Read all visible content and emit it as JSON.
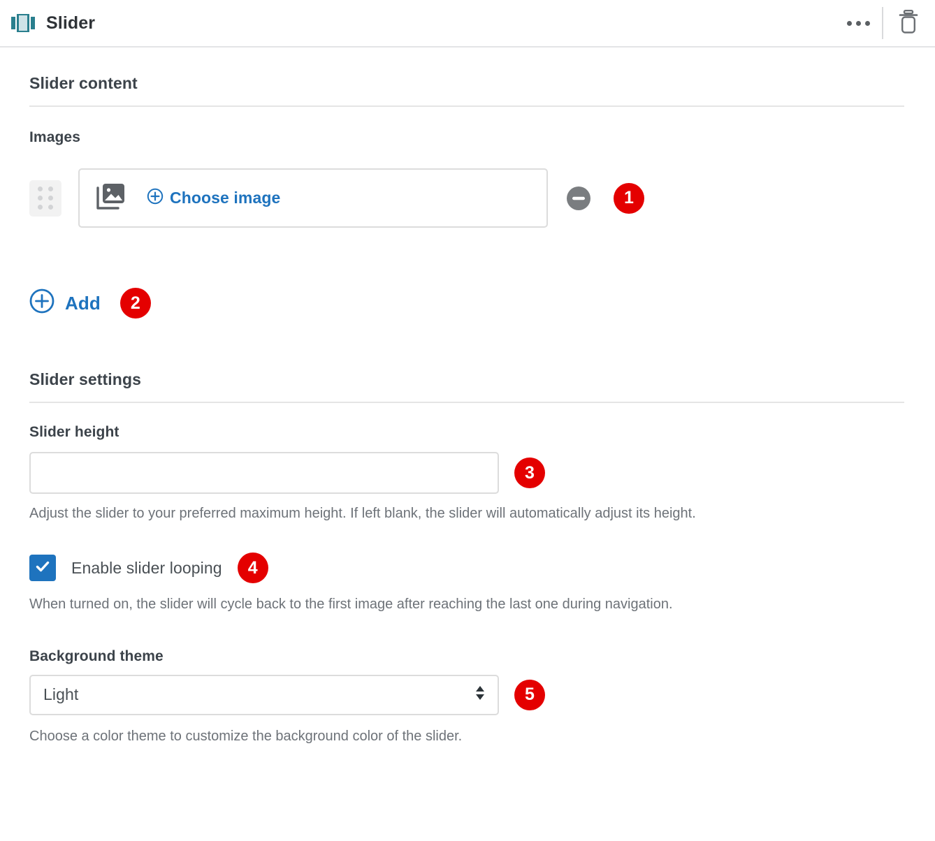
{
  "header": {
    "title": "Slider",
    "block_icon": "slider-carousel-icon",
    "more_options_icon": "ellipsis-icon",
    "delete_icon": "trash-icon"
  },
  "content_section": {
    "title": "Slider content",
    "images_label": "Images",
    "image_row": {
      "drag_handle_icon": "drag-handle-icon",
      "photo_icon": "photo-stack-icon",
      "choose_image_label": "Choose image",
      "choose_image_plus_icon": "plus-circle-icon",
      "remove_icon": "minus-circle-icon",
      "badge": "1"
    },
    "add_button": {
      "label": "Add",
      "icon": "plus-circle-icon",
      "badge": "2"
    }
  },
  "settings_section": {
    "title": "Slider settings",
    "slider_height": {
      "label": "Slider height",
      "value": "",
      "placeholder": "",
      "help": "Adjust the slider to your preferred maximum height. If left blank, the slider will automatically adjust its height.",
      "badge": "3"
    },
    "looping": {
      "label": "Enable slider looping",
      "checked": true,
      "check_icon": "checkmark-icon",
      "help": "When turned on, the slider will cycle back to the first image after reaching the last one during navigation.",
      "badge": "4"
    },
    "background_theme": {
      "label": "Background theme",
      "selected": "Light",
      "options": [
        "Light"
      ],
      "arrows_icon": "select-arrows-icon",
      "help": "Choose a color theme to customize the background color of the slider.",
      "badge": "5"
    }
  },
  "colors": {
    "badge_red": "#e40000",
    "link_blue": "#1e73be",
    "checkbox_blue": "#1e73be",
    "block_icon_teal": "#2a7f8e",
    "text_dark": "#3c434a",
    "help_gray": "#6d7278",
    "border_gray": "#dcdcdc"
  }
}
